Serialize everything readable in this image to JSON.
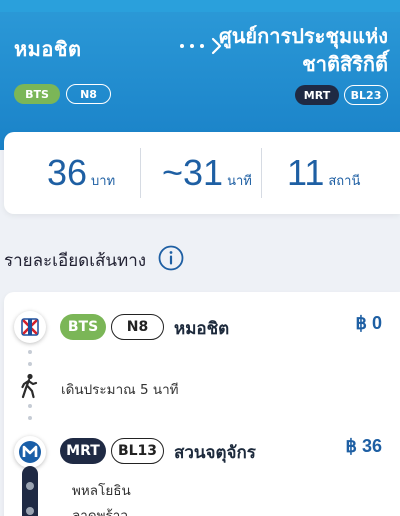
{
  "header": {
    "from_name": "หมอชิต",
    "to_name": "ศูนย์การประชุมแห่งชาติสิริกิติ์",
    "from_lines": [
      {
        "system": "BTS",
        "code": "N8"
      }
    ],
    "to_lines": [
      {
        "system": "MRT",
        "code": "BL23"
      }
    ]
  },
  "summary": {
    "fare": {
      "value": "36",
      "unit": "บาท"
    },
    "time": {
      "value": "~31",
      "unit": "นาที"
    },
    "stations": {
      "value": "11",
      "unit": "สถานี"
    }
  },
  "route_details": {
    "title": "รายละเอียดเส้นทาง",
    "steps": [
      {
        "type": "board",
        "system": "BTS",
        "code": "N8",
        "station": "หมอชิต",
        "fare": "฿ 0"
      },
      {
        "type": "walk",
        "text": "เดินประมาณ  5 นาที"
      },
      {
        "type": "board",
        "system": "MRT",
        "code": "BL13",
        "station": "สวนจตุจักร",
        "fare": "฿ 36",
        "stops": [
          "พหลโยธิน",
          "ลาดพร้าว"
        ]
      }
    ]
  },
  "colors": {
    "header_blue": "#1a82c8",
    "bts_green": "#7bb657",
    "mrt_navy": "#1f2a44",
    "accent_blue": "#1e5fa3"
  },
  "icons": [
    "arrow-right-icon",
    "info-icon",
    "bts-logo-icon",
    "walk-icon",
    "mrt-logo-icon"
  ]
}
